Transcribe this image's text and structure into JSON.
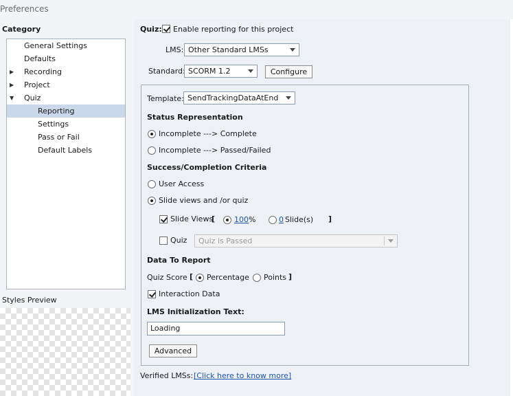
{
  "window": {
    "title": "Preferences"
  },
  "category": {
    "label": "Category",
    "items": [
      {
        "label": "General Settings",
        "arrow": ""
      },
      {
        "label": "Defaults",
        "arrow": ""
      },
      {
        "label": "Recording",
        "arrow": "▶"
      },
      {
        "label": "Project",
        "arrow": "▶"
      },
      {
        "label": "Quiz",
        "arrow": "▼"
      },
      {
        "label": "Reporting",
        "arrow": "",
        "selected": true
      },
      {
        "label": "Settings",
        "arrow": ""
      },
      {
        "label": "Pass or Fail",
        "arrow": ""
      },
      {
        "label": "Default Labels",
        "arrow": ""
      }
    ]
  },
  "styles_preview": {
    "label": "Styles Preview"
  },
  "quiz": {
    "label": "Quiz:",
    "enable_reporting_label": "Enable reporting for this project",
    "enable_reporting_checked": true
  },
  "lms": {
    "label": "LMS:",
    "value": "Other Standard LMSs"
  },
  "standard": {
    "label": "Standard:",
    "value": "SCORM 1.2",
    "configure_label": "Configure"
  },
  "template": {
    "label": "Template:",
    "value": "SendTrackingDataAtEnd"
  },
  "status_representation": {
    "heading": "Status Representation",
    "options": [
      {
        "label": "Incomplete ---> Complete",
        "checked": true
      },
      {
        "label": "Incomplete ---> Passed/Failed",
        "checked": false
      }
    ]
  },
  "success_criteria": {
    "heading": "Success/Completion Criteria",
    "options": [
      {
        "label": "User Access",
        "checked": false
      },
      {
        "label": "Slide views and /or quiz",
        "checked": true
      }
    ],
    "slide_views": {
      "label": "Slide Views",
      "checked": true,
      "open_bracket": "[",
      "close_bracket": "]",
      "percent_value": "100",
      "percent_unit": "%",
      "percent_checked": true,
      "slides_value": "0",
      "slides_unit": "Slide(s)",
      "slides_checked": false
    },
    "quiz_row": {
      "label": "Quiz",
      "checked": false,
      "dropdown_value": "Quiz is Passed"
    }
  },
  "data_to_report": {
    "heading": "Data To Report",
    "quiz_score_label": "Quiz Score",
    "open_bracket": "[",
    "close_bracket": "]",
    "percentage_label": "Percentage",
    "percentage_checked": true,
    "points_label": "Points",
    "points_checked": false,
    "interaction_data_label": "Interaction Data",
    "interaction_data_checked": true
  },
  "lms_init": {
    "heading": "LMS Initialization Text:",
    "value": "Loading"
  },
  "advanced": {
    "label": "Advanced"
  },
  "verified": {
    "label": "Verified LMSs:",
    "link": "[Click here to know more]"
  }
}
